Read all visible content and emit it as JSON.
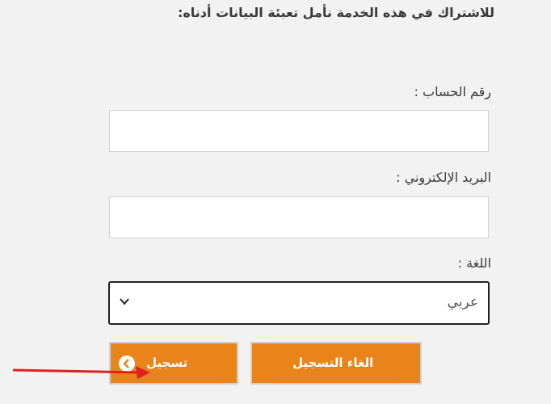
{
  "form": {
    "intro": "للاشتراك في هذه الخدمة   نأمل تعبئة البيانات أدناه:",
    "account_label": "رقم الحساب :",
    "account_value": "",
    "email_label": "البريد الإلكتروني :",
    "email_value": "",
    "language_label": "اللغة :",
    "language_value": "عربي",
    "register_label": "تسجيل",
    "cancel_label": "الغاء التسجيل"
  },
  "colors": {
    "background": "#f2f2f2",
    "button": "#e8841a",
    "annotation_arrow": "#e02020"
  },
  "icons": {
    "register": "chevron-left-circle-icon",
    "select": "chevron-down-icon",
    "annotation": "red-arrow-annotation"
  }
}
